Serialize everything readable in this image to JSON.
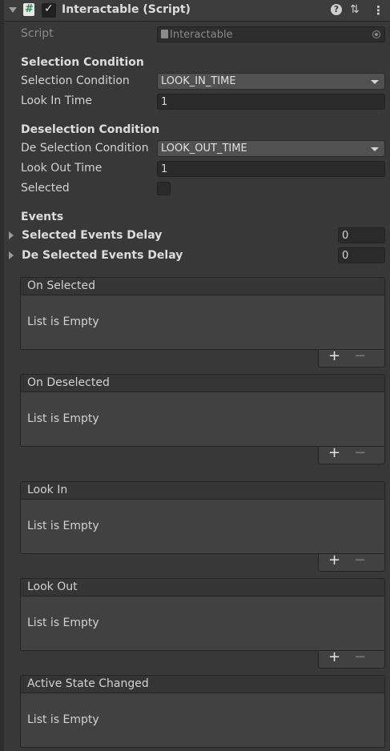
{
  "header": {
    "title": "Interactable (Script)",
    "enabled": true,
    "icons": [
      "fold-arrow",
      "script-icon",
      "help-icon",
      "preset-icon",
      "menu-icon"
    ]
  },
  "script": {
    "label": "Script",
    "value": "Interactable"
  },
  "selection": {
    "section": "Selection Condition",
    "condition_label": "Selection Condition",
    "condition_value": "LOOK_IN_TIME",
    "time_label": "Look In Time",
    "time_value": "1"
  },
  "deselection": {
    "section": "Deselection Condition",
    "condition_label": "De Selection Condition",
    "condition_value": "LOOK_OUT_TIME",
    "time_label": "Look Out Time",
    "time_value": "1",
    "selected_label": "Selected",
    "selected_checked": false
  },
  "events": {
    "section": "Events",
    "selected_delay_label": "Selected Events Delay",
    "selected_delay_value": "0",
    "deselected_delay_label": "De Selected Events Delay",
    "deselected_delay_value": "0",
    "lists": [
      {
        "title": "On Selected",
        "empty": "List is Empty"
      },
      {
        "title": "On Deselected",
        "empty": "List is Empty"
      },
      {
        "title": "Look In",
        "empty": "List is Empty"
      },
      {
        "title": "Look Out",
        "empty": "List is Empty"
      },
      {
        "title": "Active State Changed",
        "empty": "List is Empty"
      }
    ],
    "add_label": "+",
    "remove_label": "−"
  },
  "colors": {
    "background": "#383838",
    "field": "#2a2a2a",
    "dropdown": "#515151",
    "text": "#d2d2d2"
  }
}
